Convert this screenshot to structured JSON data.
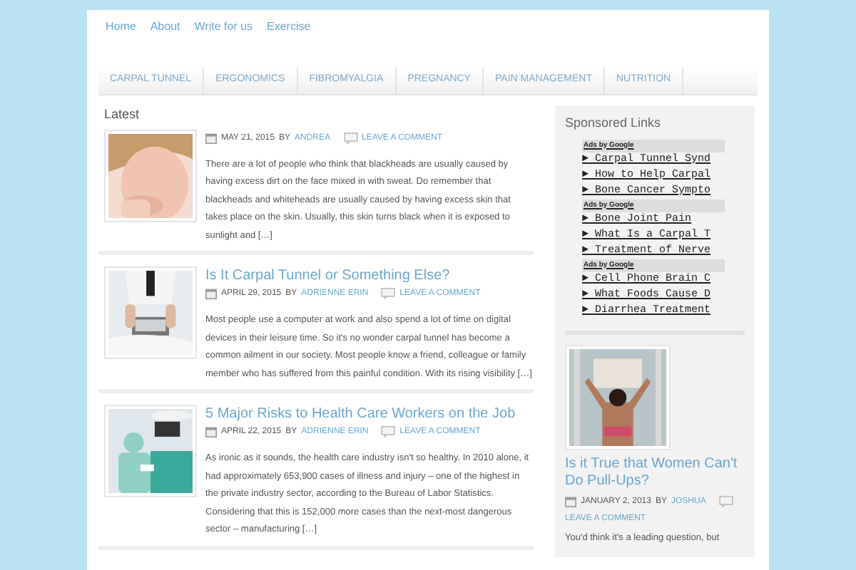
{
  "top_nav": [
    "Home",
    "About",
    "Write for us",
    "Exercise"
  ],
  "categories": [
    "CARPAL TUNNEL",
    "ERGONOMICS",
    "FIBROMYALGIA",
    "PREGNANCY",
    "PAIN MANAGEMENT",
    "NUTRITION"
  ],
  "latest": {
    "heading": "Latest",
    "posts": [
      {
        "kind": "picture",
        "date": "MAY 21, 2015",
        "by": "BY",
        "author": "ANDREA",
        "comments": "LEAVE A COMMENT",
        "excerpt": "There are a lot of people who think that blackheads are usually caused by having excess dirt on the face mixed in with sweat. Do remember that blackheads and whiteheads are usually caused by having excess skin that takes place on the skin. Usually, this skin turns black when it is exposed to sunlight and […]"
      },
      {
        "kind": "picture",
        "title": "Is It Carpal Tunnel or Something Else?",
        "date": "APRIL 29, 2015",
        "by": "BY",
        "author": "ADRIENNE ERIN",
        "comments": "LEAVE A COMMENT",
        "excerpt": "Most people use a computer at work and also spend a lot of time on digital devices in their leisure time. So it's no wonder carpal tunnel has become a common ailment in our society. Most people know a friend, colleague or family member who has suffered from this painful condition. With its rising visibility […]"
      },
      {
        "kind": "picture",
        "title": "5 Major Risks to Health Care Workers on the Job",
        "date": "APRIL 22, 2015",
        "by": "BY",
        "author": "ADRIENNE ERIN",
        "comments": "LEAVE A COMMENT",
        "excerpt": "As ironic as it sounds, the health care industry isn't so healthy. In 2010 alone, it had approximately 653,900 cases of illness and injury – one of the highest in the private industry sector, according to the Bureau of Labor Statistics. Considering that this is 152,000 more cases than the next-most dangerous sector – manufacturing […]"
      }
    ]
  },
  "sidebar": {
    "heading": "Sponsored Links",
    "ad_blocks": [
      {
        "header": "Ads by Google",
        "links": [
          "Carpal Tunnel Synd",
          "How to Help Carpal",
          "Bone Cancer Sympto"
        ]
      },
      {
        "header": "Ads by Google",
        "links": [
          "Bone Joint Pain",
          "What Is a Carpal T",
          "Treatment of Nerve"
        ]
      },
      {
        "header": "Ads by Google",
        "links": [
          "Cell Phone Brain C",
          "What Foods Cause D",
          "Diarrhea Treatment"
        ]
      }
    ],
    "featured": {
      "title": "Is it True that Women Can't Do Pull-Ups?",
      "date": "JANUARY 2, 2013",
      "by": "BY",
      "author": "JOSHUA",
      "comments": "LEAVE A COMMENT",
      "excerpt": "You'd think it's a leading question, but"
    }
  },
  "link_marker": "►"
}
